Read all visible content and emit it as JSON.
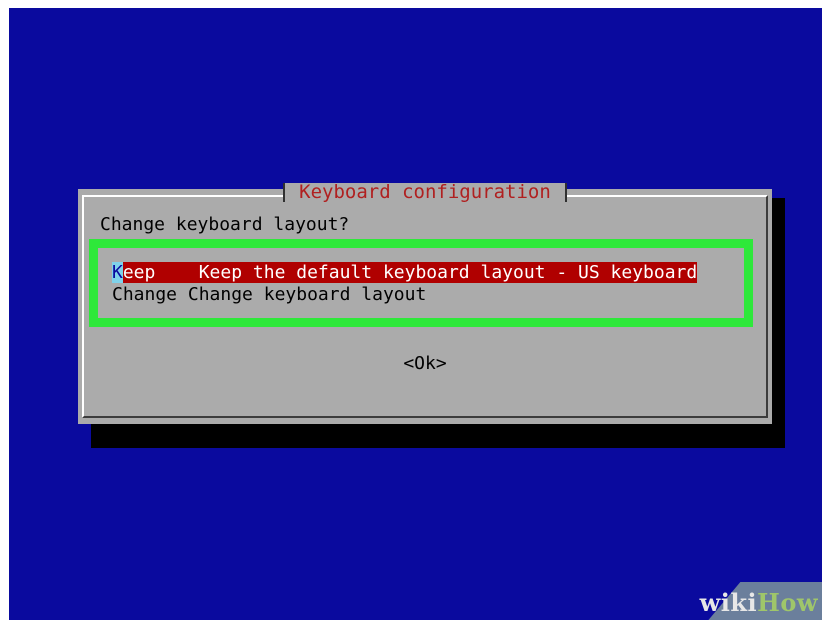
{
  "dialog": {
    "title": "Keyboard configuration",
    "prompt": "Change keyboard layout?",
    "options": [
      {
        "key_first": "K",
        "key_rest": "eep",
        "description": "Keep the default keyboard layout - US keyboard",
        "selected": true
      },
      {
        "key": "Change",
        "description": "Change keyboard layout",
        "selected": false
      }
    ],
    "ok_label": "<Ok>"
  },
  "watermark": {
    "part1": "wiki",
    "part2": "How"
  },
  "colors": {
    "screen_background": "#0a0a9e",
    "dialog_background": "#ababab",
    "title_text": "#b02020",
    "selected_row": "#b00000",
    "highlight_annotation": "#2ee83a",
    "cursor": "#7fd2ea"
  }
}
